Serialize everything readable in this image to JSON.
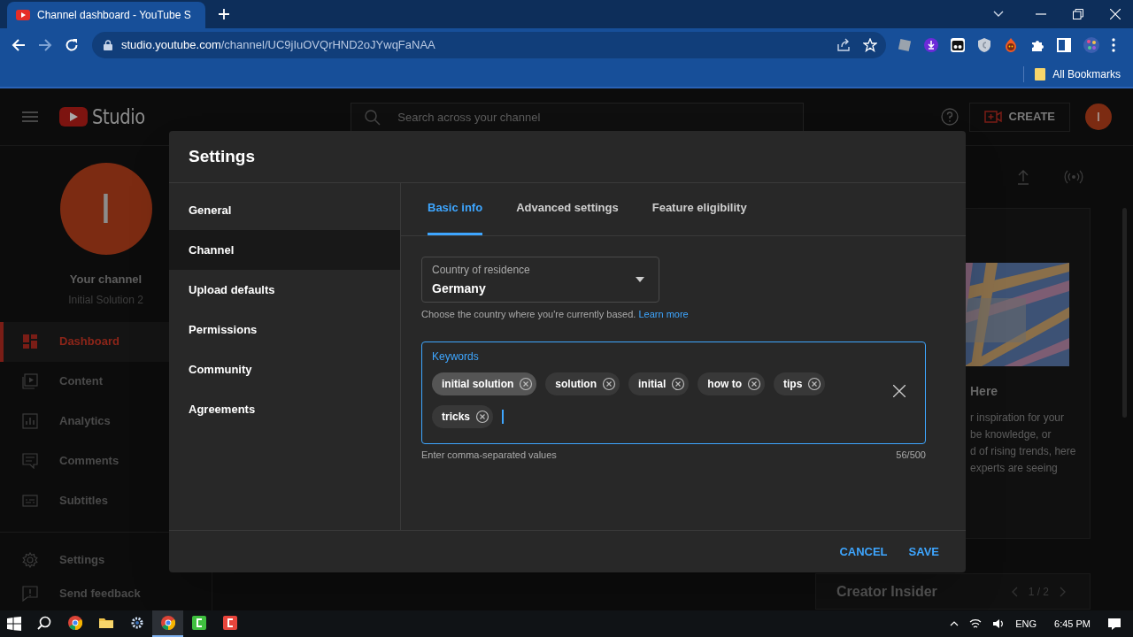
{
  "browser": {
    "tabs": [
      {
        "title": "Channel dashboard - YouTube S",
        "selected": true
      }
    ],
    "url_host": "studio.youtube.com",
    "url_path": "/channel/UC9jIuOVQrHND2oJYwqFaNAA",
    "bookmarks_label": "All Bookmarks"
  },
  "studio": {
    "logo_text": "Studio",
    "search_placeholder": "Search across your channel",
    "create_label": "CREATE",
    "avatar_letter": "I",
    "channel": {
      "avatar_letter": "I",
      "title": "Your channel",
      "name": "Initial Solution 2"
    },
    "nav": [
      {
        "label": "Dashboard",
        "kind": "dashboard",
        "selected": true
      },
      {
        "label": "Content",
        "kind": "content",
        "selected": false
      },
      {
        "label": "Analytics",
        "kind": "analytics",
        "selected": false
      },
      {
        "label": "Comments",
        "kind": "comments",
        "selected": false
      },
      {
        "label": "Subtitles",
        "kind": "subtitles",
        "selected": false
      }
    ],
    "footer_nav": [
      {
        "label": "Settings",
        "kind": "settings"
      },
      {
        "label": "Send feedback",
        "kind": "feedback"
      }
    ],
    "card": {
      "heading": "Here",
      "lines": [
        "r inspiration for your",
        "be knowledge, or",
        "d of rising trends, here",
        "experts are seeing"
      ]
    },
    "insider": {
      "title": "Creator Insider",
      "pager": "1 / 2"
    }
  },
  "dialog": {
    "title": "Settings",
    "nav": [
      {
        "label": "General",
        "selected": false
      },
      {
        "label": "Channel",
        "selected": true
      },
      {
        "label": "Upload defaults",
        "selected": false
      },
      {
        "label": "Permissions",
        "selected": false
      },
      {
        "label": "Community",
        "selected": false
      },
      {
        "label": "Agreements",
        "selected": false
      }
    ],
    "tabs": [
      {
        "label": "Basic info",
        "selected": true
      },
      {
        "label": "Advanced settings",
        "selected": false
      },
      {
        "label": "Feature eligibility",
        "selected": false
      }
    ],
    "country": {
      "label": "Country of residence",
      "value": "Germany",
      "helper": "Choose the country where you're currently based.",
      "link": "Learn more"
    },
    "keywords": {
      "label": "Keywords",
      "focused": true,
      "chips": [
        {
          "text": "initial solution",
          "hovered": true
        },
        {
          "text": "solution",
          "hovered": false
        },
        {
          "text": "initial",
          "hovered": false
        },
        {
          "text": "how to",
          "hovered": false
        },
        {
          "text": "tips",
          "hovered": false
        },
        {
          "text": "tricks",
          "hovered": false
        }
      ],
      "helper": "Enter comma-separated values",
      "counter": "56/500"
    },
    "buttons": [
      "CANCEL",
      "SAVE"
    ]
  },
  "taskbar": {
    "apps": [
      {
        "kind": "search",
        "active": false
      },
      {
        "kind": "chrome",
        "active": false
      },
      {
        "kind": "folder",
        "active": false
      },
      {
        "kind": "gear",
        "active": false
      },
      {
        "kind": "chrome",
        "active": true
      },
      {
        "kind": "green",
        "active": false
      },
      {
        "kind": "red",
        "active": false
      }
    ],
    "language": "ENG",
    "time": "6:45 PM"
  }
}
